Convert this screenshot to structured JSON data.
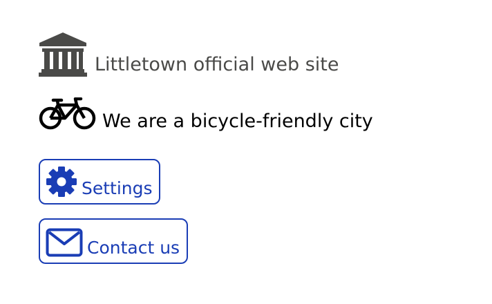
{
  "site": {
    "icon": "building-columns-icon",
    "title": "Littletown official web site",
    "text_color": "#4a4a48"
  },
  "tagline": {
    "icon": "bicycle-icon",
    "text": "We are a bicycle-friendly city",
    "text_color": "#000000"
  },
  "buttons": {
    "accent": "#1a3db5",
    "settings": {
      "icon": "gear-icon",
      "label": "Settings"
    },
    "contact": {
      "icon": "envelope-icon",
      "label": "Contact us"
    }
  }
}
